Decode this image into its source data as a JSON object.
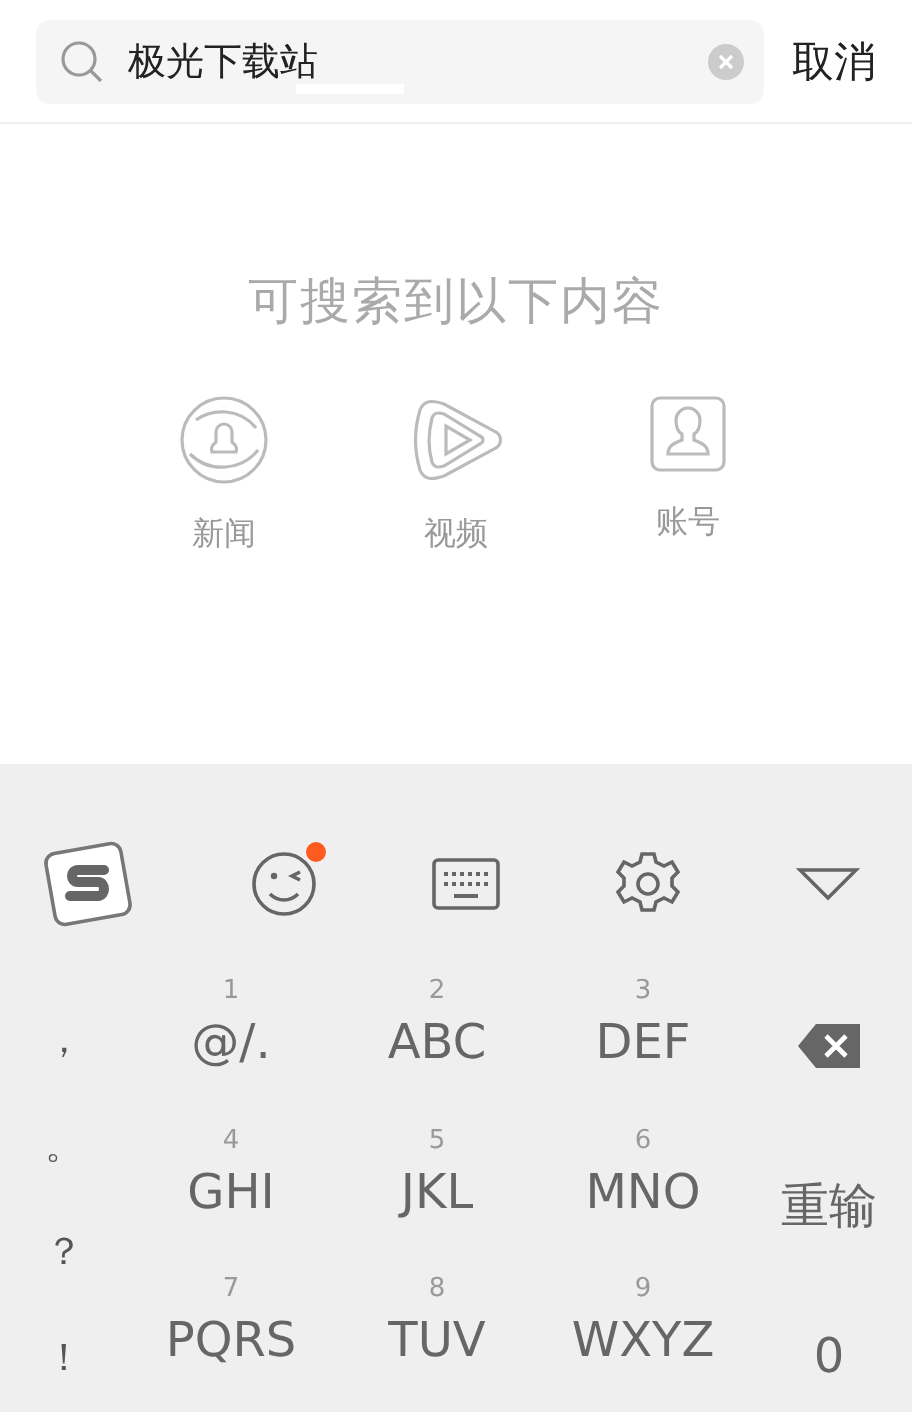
{
  "search": {
    "value": "极光下载站",
    "cancel": "取消"
  },
  "heading": "可搜索到以下内容",
  "categories": [
    {
      "kind": "news",
      "label": "新闻"
    },
    {
      "kind": "video",
      "label": "视频"
    },
    {
      "kind": "account",
      "label": "账号"
    }
  ],
  "keyboard": {
    "toolbar": [
      {
        "kind": "logo"
      },
      {
        "kind": "emoji",
        "notification": true
      },
      {
        "kind": "keyboard"
      },
      {
        "kind": "settings"
      },
      {
        "kind": "collapse"
      }
    ],
    "punctuation": [
      "，",
      "。",
      "？",
      "！"
    ],
    "keys": [
      {
        "number": "1",
        "letters": "@/."
      },
      {
        "number": "2",
        "letters": "ABC"
      },
      {
        "number": "3",
        "letters": "DEF"
      },
      {
        "number": "4",
        "letters": "GHI"
      },
      {
        "number": "5",
        "letters": "JKL"
      },
      {
        "number": "6",
        "letters": "MNO"
      },
      {
        "number": "7",
        "letters": "PQRS"
      },
      {
        "number": "8",
        "letters": "TUV"
      },
      {
        "number": "9",
        "letters": "WXYZ"
      }
    ],
    "side_keys": [
      {
        "kind": "delete"
      },
      {
        "kind": "text",
        "label": "重输"
      },
      {
        "kind": "text",
        "label": "0"
      }
    ]
  }
}
